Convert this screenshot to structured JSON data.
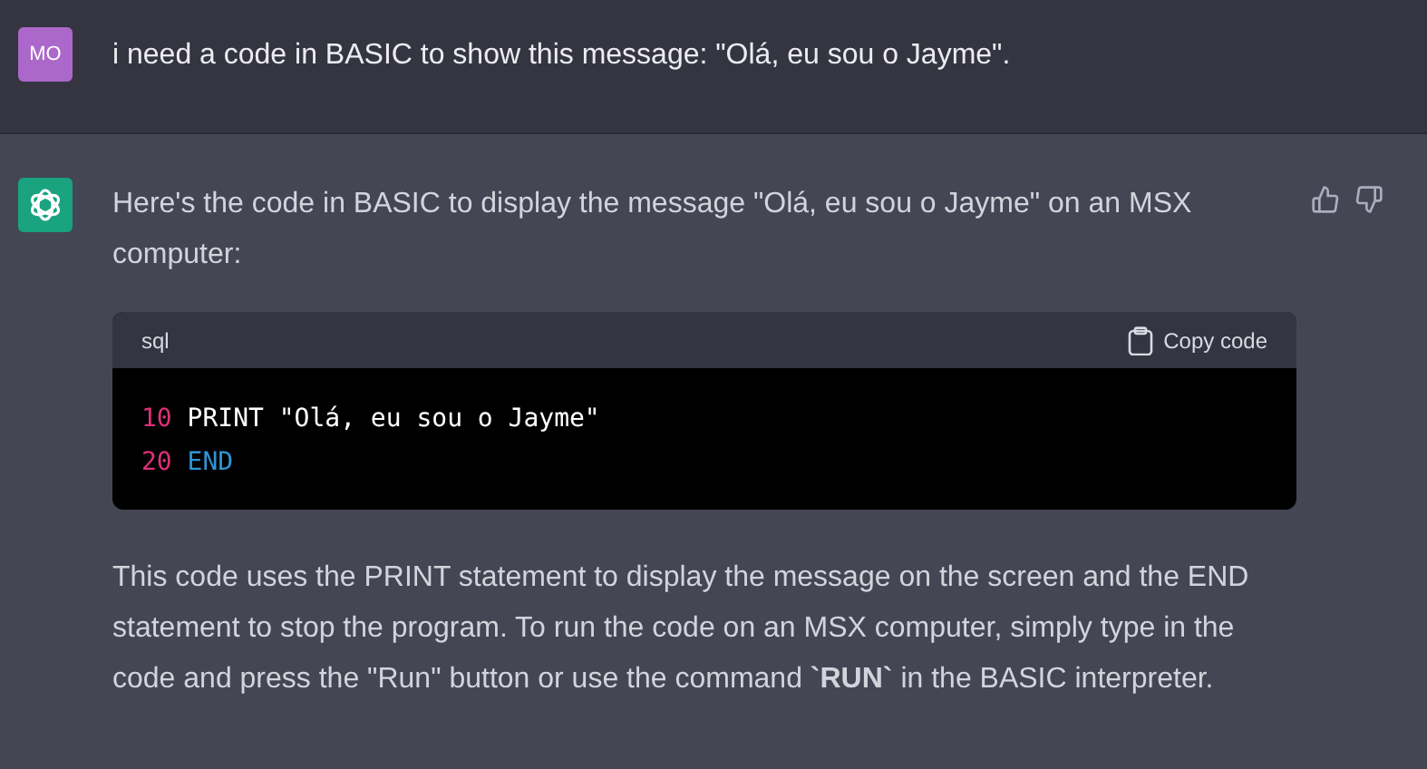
{
  "user_message": {
    "avatar": "MO",
    "text": "i need a code in BASIC to show this message: \"Olá, eu sou o Jayme\"."
  },
  "assistant_message": {
    "intro": "Here's the code in BASIC to display the message \"Olá, eu sou o Jayme\" on an MSX computer:",
    "code_block": {
      "language": "sql",
      "copy_label": "Copy code",
      "lines": [
        [
          {
            "kind": "number",
            "text": "10"
          },
          {
            "kind": "plain",
            "text": " PRINT \"Olá, eu sou o Jayme\""
          }
        ],
        [
          {
            "kind": "number",
            "text": "20"
          },
          {
            "kind": "keyword",
            "text": " END"
          }
        ]
      ]
    },
    "explanation": "This code uses the PRINT statement to display the message on the screen and the END statement to stop the program. To run the code on an MSX computer, simply type in the code and press the \"Run\" button or use the command **`RUN`** in the BASIC interpreter."
  }
}
